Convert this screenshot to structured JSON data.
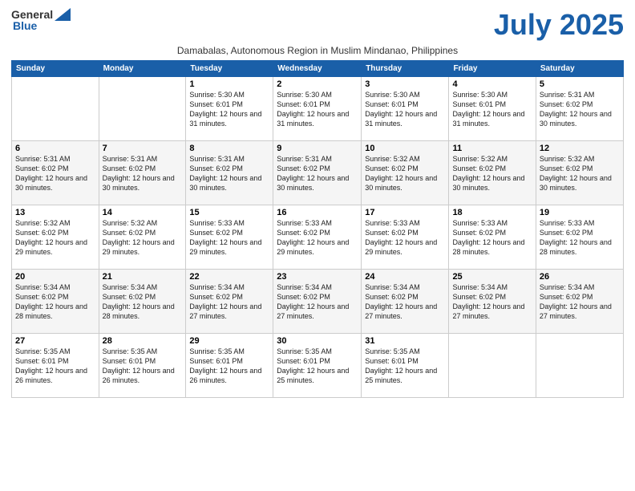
{
  "logo": {
    "general": "General",
    "blue": "Blue"
  },
  "title": "July 2025",
  "subtitle": "Damabalas, Autonomous Region in Muslim Mindanao, Philippines",
  "weekdays": [
    "Sunday",
    "Monday",
    "Tuesday",
    "Wednesday",
    "Thursday",
    "Friday",
    "Saturday"
  ],
  "weeks": [
    [
      {
        "day": "",
        "info": ""
      },
      {
        "day": "",
        "info": ""
      },
      {
        "day": "1",
        "info": "Sunrise: 5:30 AM\nSunset: 6:01 PM\nDaylight: 12 hours and 31 minutes."
      },
      {
        "day": "2",
        "info": "Sunrise: 5:30 AM\nSunset: 6:01 PM\nDaylight: 12 hours and 31 minutes."
      },
      {
        "day": "3",
        "info": "Sunrise: 5:30 AM\nSunset: 6:01 PM\nDaylight: 12 hours and 31 minutes."
      },
      {
        "day": "4",
        "info": "Sunrise: 5:30 AM\nSunset: 6:01 PM\nDaylight: 12 hours and 31 minutes."
      },
      {
        "day": "5",
        "info": "Sunrise: 5:31 AM\nSunset: 6:02 PM\nDaylight: 12 hours and 30 minutes."
      }
    ],
    [
      {
        "day": "6",
        "info": "Sunrise: 5:31 AM\nSunset: 6:02 PM\nDaylight: 12 hours and 30 minutes."
      },
      {
        "day": "7",
        "info": "Sunrise: 5:31 AM\nSunset: 6:02 PM\nDaylight: 12 hours and 30 minutes."
      },
      {
        "day": "8",
        "info": "Sunrise: 5:31 AM\nSunset: 6:02 PM\nDaylight: 12 hours and 30 minutes."
      },
      {
        "day": "9",
        "info": "Sunrise: 5:31 AM\nSunset: 6:02 PM\nDaylight: 12 hours and 30 minutes."
      },
      {
        "day": "10",
        "info": "Sunrise: 5:32 AM\nSunset: 6:02 PM\nDaylight: 12 hours and 30 minutes."
      },
      {
        "day": "11",
        "info": "Sunrise: 5:32 AM\nSunset: 6:02 PM\nDaylight: 12 hours and 30 minutes."
      },
      {
        "day": "12",
        "info": "Sunrise: 5:32 AM\nSunset: 6:02 PM\nDaylight: 12 hours and 30 minutes."
      }
    ],
    [
      {
        "day": "13",
        "info": "Sunrise: 5:32 AM\nSunset: 6:02 PM\nDaylight: 12 hours and 29 minutes."
      },
      {
        "day": "14",
        "info": "Sunrise: 5:32 AM\nSunset: 6:02 PM\nDaylight: 12 hours and 29 minutes."
      },
      {
        "day": "15",
        "info": "Sunrise: 5:33 AM\nSunset: 6:02 PM\nDaylight: 12 hours and 29 minutes."
      },
      {
        "day": "16",
        "info": "Sunrise: 5:33 AM\nSunset: 6:02 PM\nDaylight: 12 hours and 29 minutes."
      },
      {
        "day": "17",
        "info": "Sunrise: 5:33 AM\nSunset: 6:02 PM\nDaylight: 12 hours and 29 minutes."
      },
      {
        "day": "18",
        "info": "Sunrise: 5:33 AM\nSunset: 6:02 PM\nDaylight: 12 hours and 28 minutes."
      },
      {
        "day": "19",
        "info": "Sunrise: 5:33 AM\nSunset: 6:02 PM\nDaylight: 12 hours and 28 minutes."
      }
    ],
    [
      {
        "day": "20",
        "info": "Sunrise: 5:34 AM\nSunset: 6:02 PM\nDaylight: 12 hours and 28 minutes."
      },
      {
        "day": "21",
        "info": "Sunrise: 5:34 AM\nSunset: 6:02 PM\nDaylight: 12 hours and 28 minutes."
      },
      {
        "day": "22",
        "info": "Sunrise: 5:34 AM\nSunset: 6:02 PM\nDaylight: 12 hours and 27 minutes."
      },
      {
        "day": "23",
        "info": "Sunrise: 5:34 AM\nSunset: 6:02 PM\nDaylight: 12 hours and 27 minutes."
      },
      {
        "day": "24",
        "info": "Sunrise: 5:34 AM\nSunset: 6:02 PM\nDaylight: 12 hours and 27 minutes."
      },
      {
        "day": "25",
        "info": "Sunrise: 5:34 AM\nSunset: 6:02 PM\nDaylight: 12 hours and 27 minutes."
      },
      {
        "day": "26",
        "info": "Sunrise: 5:34 AM\nSunset: 6:02 PM\nDaylight: 12 hours and 27 minutes."
      }
    ],
    [
      {
        "day": "27",
        "info": "Sunrise: 5:35 AM\nSunset: 6:01 PM\nDaylight: 12 hours and 26 minutes."
      },
      {
        "day": "28",
        "info": "Sunrise: 5:35 AM\nSunset: 6:01 PM\nDaylight: 12 hours and 26 minutes."
      },
      {
        "day": "29",
        "info": "Sunrise: 5:35 AM\nSunset: 6:01 PM\nDaylight: 12 hours and 26 minutes."
      },
      {
        "day": "30",
        "info": "Sunrise: 5:35 AM\nSunset: 6:01 PM\nDaylight: 12 hours and 25 minutes."
      },
      {
        "day": "31",
        "info": "Sunrise: 5:35 AM\nSunset: 6:01 PM\nDaylight: 12 hours and 25 minutes."
      },
      {
        "day": "",
        "info": ""
      },
      {
        "day": "",
        "info": ""
      }
    ]
  ]
}
